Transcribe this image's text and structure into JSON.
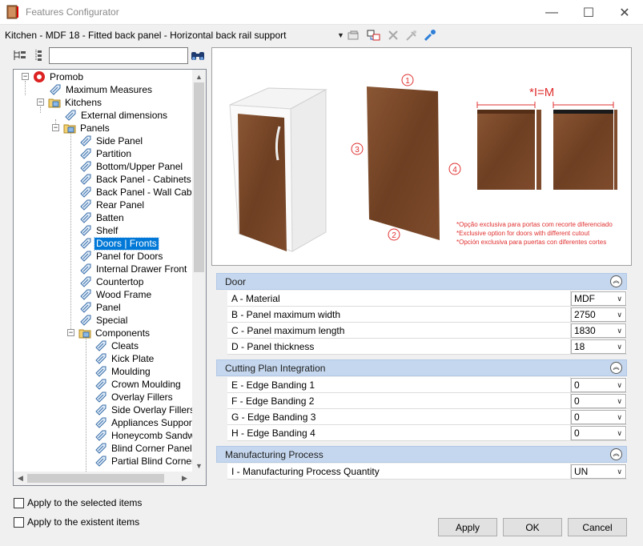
{
  "window": {
    "title": "Features Configurator",
    "minimize": "—",
    "maximize": "☐",
    "close": "✕"
  },
  "pathbar": {
    "text": "Kitchen - MDF 18 - Fitted back panel - Horizontal back rail support",
    "dropdown": "▼"
  },
  "search": {
    "value": "",
    "placeholder": ""
  },
  "tree": {
    "root": "Promob",
    "items": [
      "Maximum Measures",
      "Kitchens",
      "External dimensions",
      "Panels",
      "Side Panel",
      "Partition",
      "Bottom/Upper Panel",
      "Back Panel - Cabinets",
      "Back Panel - Wall Cabine",
      "Rear Panel",
      "Batten",
      "Shelf",
      "Doors | Fronts",
      "Panel for Doors",
      "Internal Drawer Front",
      "Countertop",
      "Wood Frame",
      "Panel",
      "Special",
      "Components",
      "Cleats",
      "Kick Plate",
      "Moulding",
      "Crown Moulding",
      "Overlay Fillers",
      "Side Overlay Fillers",
      "Appliances Support",
      "Honeycomb Sandwic",
      "Blind Corner Panel",
      "Partial Blind Corner P"
    ],
    "expander_minus": "−"
  },
  "preview": {
    "formula": "*I=M",
    "numbers": [
      "1",
      "2",
      "3",
      "4"
    ],
    "notes": [
      "*Opção exclusiva para portas com recorte diferenciado",
      "*Exclusive option for doors with different cutout",
      "*Opción exclusiva para puertas con diferentes cortes"
    ]
  },
  "sections": [
    {
      "title": "Door",
      "rows": [
        {
          "label": "A - Material",
          "value": "MDF"
        },
        {
          "label": "B - Panel maximum width",
          "value": "2750"
        },
        {
          "label": "C - Panel maximum length",
          "value": "1830"
        },
        {
          "label": "D - Panel thickness",
          "value": "18"
        }
      ]
    },
    {
      "title": "Cutting Plan Integration",
      "rows": [
        {
          "label": "E - Edge Banding 1",
          "value": "0"
        },
        {
          "label": "F - Edge Banding 2",
          "value": "0"
        },
        {
          "label": "G - Edge Banding 3",
          "value": "0"
        },
        {
          "label": "H - Edge Banding 4",
          "value": "0"
        }
      ]
    },
    {
      "title": "Manufacturing Process",
      "rows": [
        {
          "label": "I - Manufacturing Process Quantity",
          "value": "UN"
        }
      ]
    }
  ],
  "collapse_glyph": "︽",
  "dropdown_glyph": "∨",
  "checkboxes": [
    {
      "label": "Apply to the selected items",
      "checked": false
    },
    {
      "label": "Apply to the existent items",
      "checked": false
    }
  ],
  "buttons": {
    "apply": "Apply",
    "ok": "OK",
    "cancel": "Cancel"
  },
  "scroll": {
    "up": "▲",
    "down": "▼",
    "left": "◀",
    "right": "▶"
  },
  "colors": {
    "accent": "#0078d7",
    "section": "#c5d7ee",
    "marker": "#e03030",
    "wood": "#7a4a2a"
  }
}
